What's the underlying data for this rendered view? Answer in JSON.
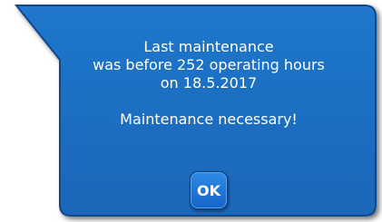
{
  "dialog": {
    "lines": [
      "Last maintenance",
      "was before 252 operating hours",
      "on 18.5.2017"
    ],
    "notice": "Maintenance necessary!",
    "ok_label": "OK"
  },
  "colors": {
    "bubble_fill": "#1d6fc3",
    "bubble_border": "#0d4a8f",
    "text": "#ffffff",
    "button_fill": "#1f78d6"
  }
}
